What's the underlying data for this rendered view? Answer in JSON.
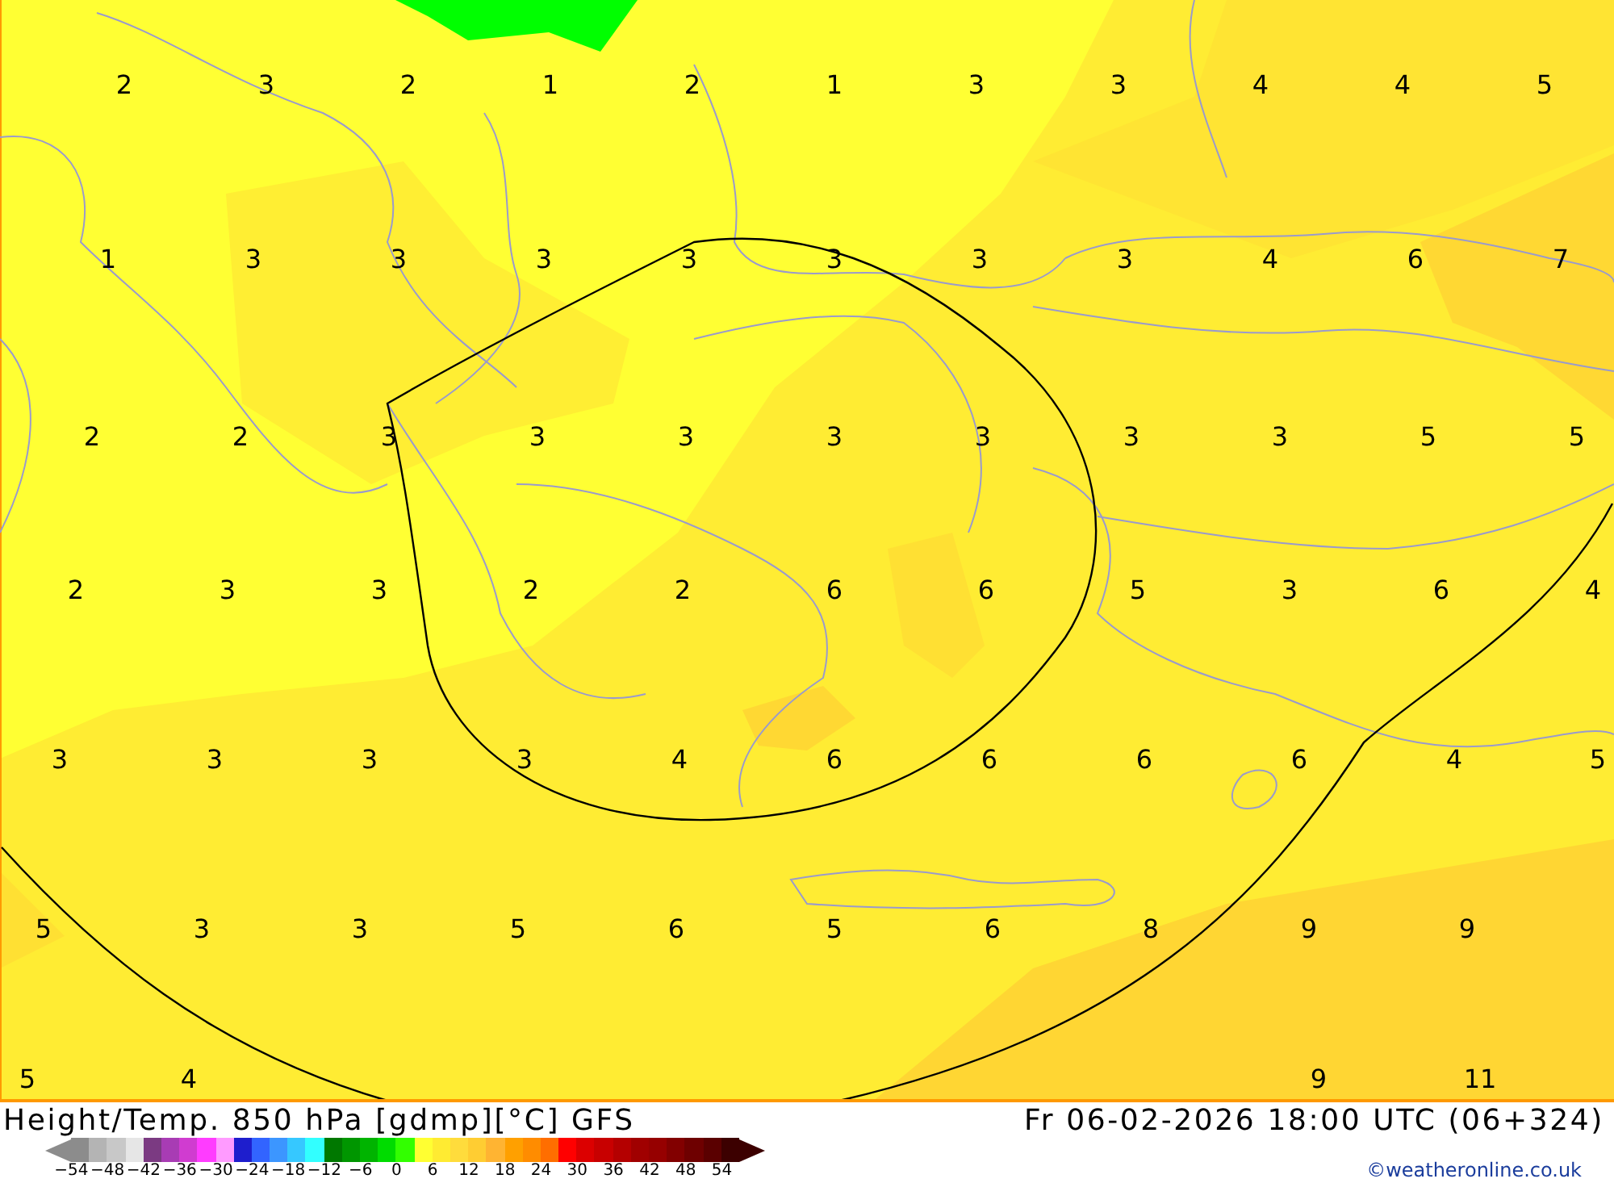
{
  "map": {
    "value_rows": [
      [
        "2",
        "3",
        "2",
        "1",
        "2",
        "1",
        "3",
        "3",
        "4",
        "4",
        "5"
      ],
      [
        "1",
        "3",
        "3",
        "3",
        "3",
        "3",
        "3",
        "3",
        "4",
        "6",
        "7"
      ],
      [
        "2",
        "2",
        "3",
        "3",
        "3",
        "3",
        "3",
        "3",
        "3",
        "5",
        "5"
      ],
      [
        "2",
        "3",
        "3",
        "2",
        "2",
        "6",
        "6",
        "5",
        "3",
        "6",
        "4"
      ],
      [
        "3",
        "3",
        "3",
        "3",
        "4",
        "6",
        "6",
        "6",
        "6",
        "4",
        "5"
      ],
      [
        "5",
        "3",
        "3",
        "5",
        "6",
        "5",
        "6",
        "8",
        "9",
        "9"
      ],
      [
        "5",
        "4",
        null,
        null,
        null,
        null,
        null,
        null,
        "9",
        "11"
      ]
    ]
  },
  "footer": {
    "title": "Height/Temp. 850 hPa [gdmp][°C] GFS",
    "valid_time": "Fr 06-02-2026 18:00 UTC (06+324)",
    "credit": "©weatheronline.co.uk"
  },
  "legend": {
    "swatches": [
      {
        "color": "#8c8c8c"
      },
      {
        "color": "#b4b4b4"
      },
      {
        "color": "#c8c8c8"
      },
      {
        "color": "#e6e6e6"
      },
      {
        "color": "#7b3a82"
      },
      {
        "color": "#a83cb4"
      },
      {
        "color": "#d03cd0"
      },
      {
        "color": "#ff3cff"
      },
      {
        "color": "#ff9bff"
      },
      {
        "color": "#1e1ecd"
      },
      {
        "color": "#3264ff"
      },
      {
        "color": "#3c96ff"
      },
      {
        "color": "#36c8ff"
      },
      {
        "color": "#32ffff"
      },
      {
        "color": "#007800"
      },
      {
        "color": "#009600"
      },
      {
        "color": "#00b400"
      },
      {
        "color": "#00dc00"
      },
      {
        "color": "#32ff00"
      },
      {
        "color": "#ffff32"
      },
      {
        "color": "#ffeb32"
      },
      {
        "color": "#ffdc3c"
      },
      {
        "color": "#ffcd32"
      },
      {
        "color": "#ffb432"
      },
      {
        "color": "#ffa000"
      },
      {
        "color": "#ff8c00"
      },
      {
        "color": "#ff6e00"
      },
      {
        "color": "#ff0000"
      },
      {
        "color": "#dc0000"
      },
      {
        "color": "#c80000"
      },
      {
        "color": "#b40000"
      },
      {
        "color": "#a00000"
      },
      {
        "color": "#960000"
      },
      {
        "color": "#820000"
      },
      {
        "color": "#6e0000"
      },
      {
        "color": "#5a0000"
      },
      {
        "color": "#3c0000"
      }
    ],
    "ticks": [
      "−54",
      "−48",
      "−42",
      "−36",
      "−30",
      "−24",
      "−18",
      "−12",
      "−6",
      "0",
      "6",
      "12",
      "18",
      "24",
      "30",
      "36",
      "42",
      "48",
      "54"
    ]
  }
}
